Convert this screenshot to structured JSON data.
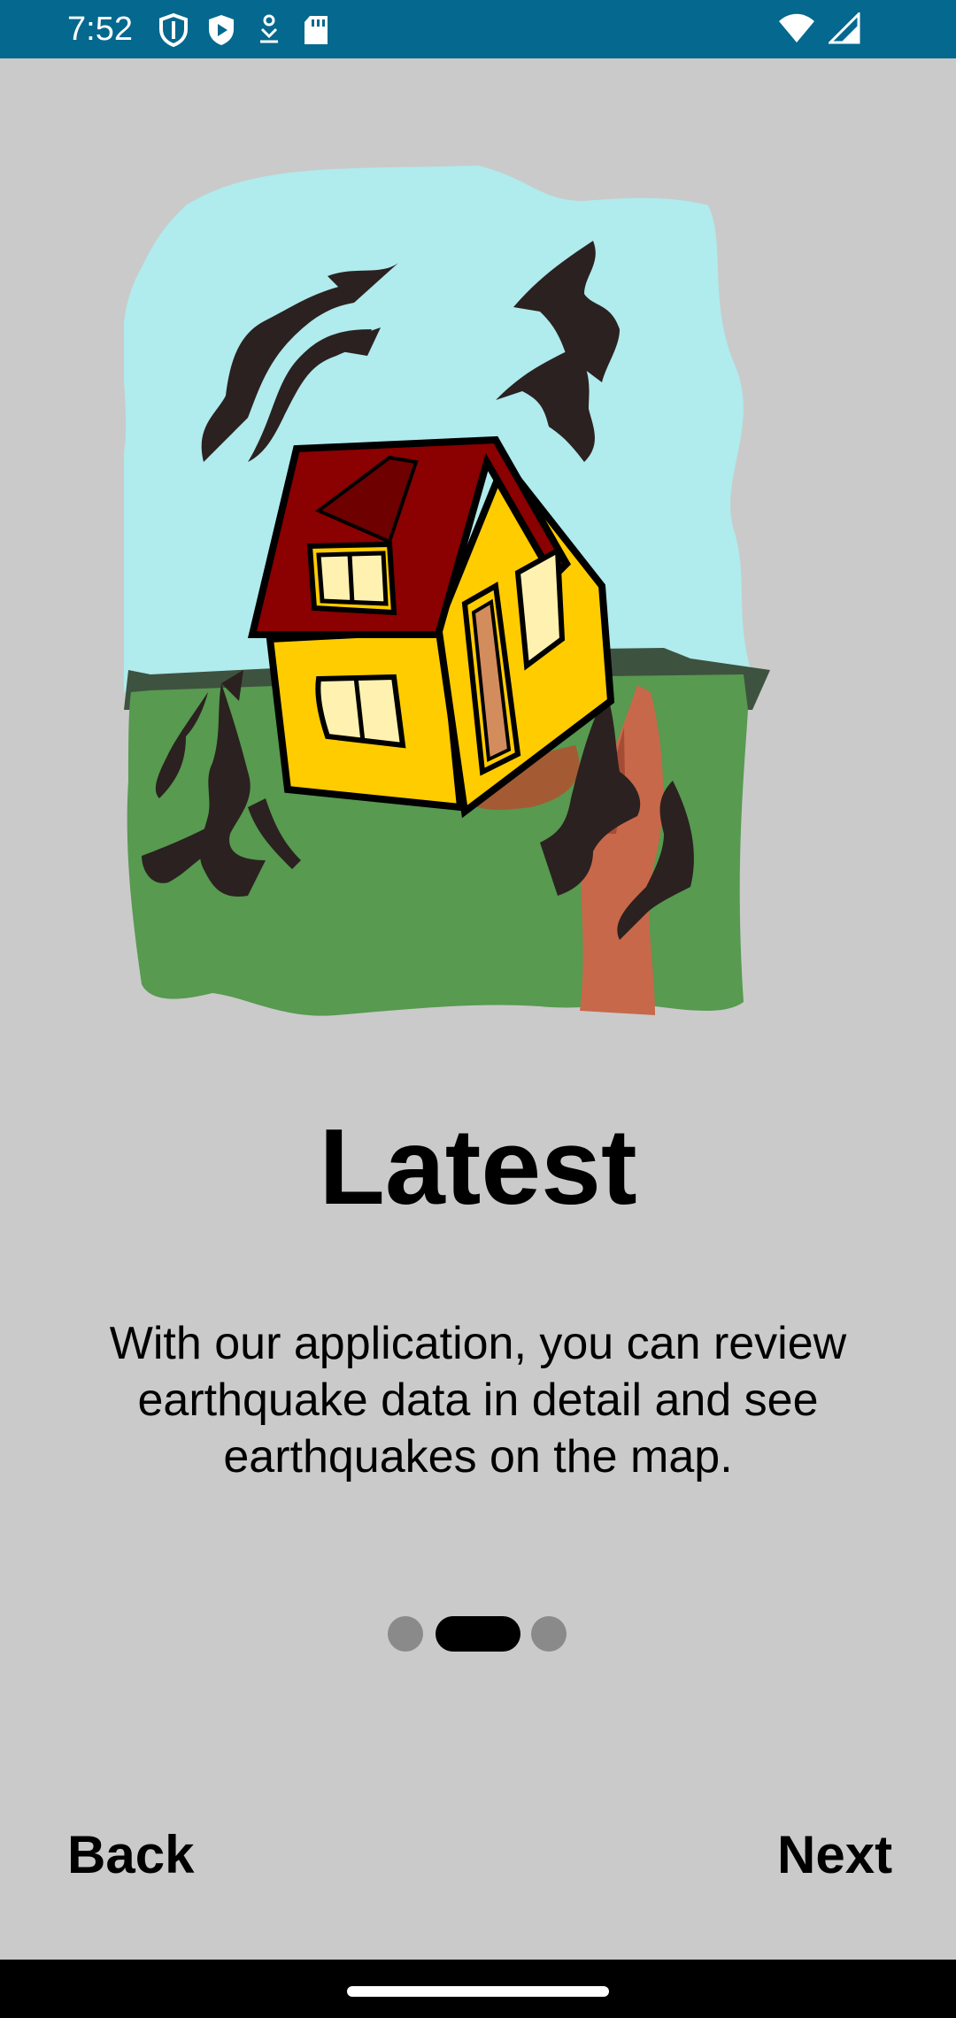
{
  "status_bar": {
    "time": "7:52",
    "left_icons": [
      "shield-icon",
      "play-shield-icon",
      "download-icon",
      "sd-card-icon"
    ],
    "right_icons": [
      "wifi-icon",
      "signal-icon"
    ],
    "background_color": "#04688f"
  },
  "onboarding": {
    "illustration": "earthquake-house-icon",
    "title": "Latest",
    "description": "With our application, you can review earthquake data in detail and see earthquakes on the map.",
    "page_indicator": {
      "total": 3,
      "active_index": 1
    }
  },
  "buttons": {
    "back_label": "Back",
    "next_label": "Next"
  },
  "colors": {
    "background": "#cacaca",
    "dot_inactive": "#8a8a8a",
    "dot_active": "#000000"
  }
}
